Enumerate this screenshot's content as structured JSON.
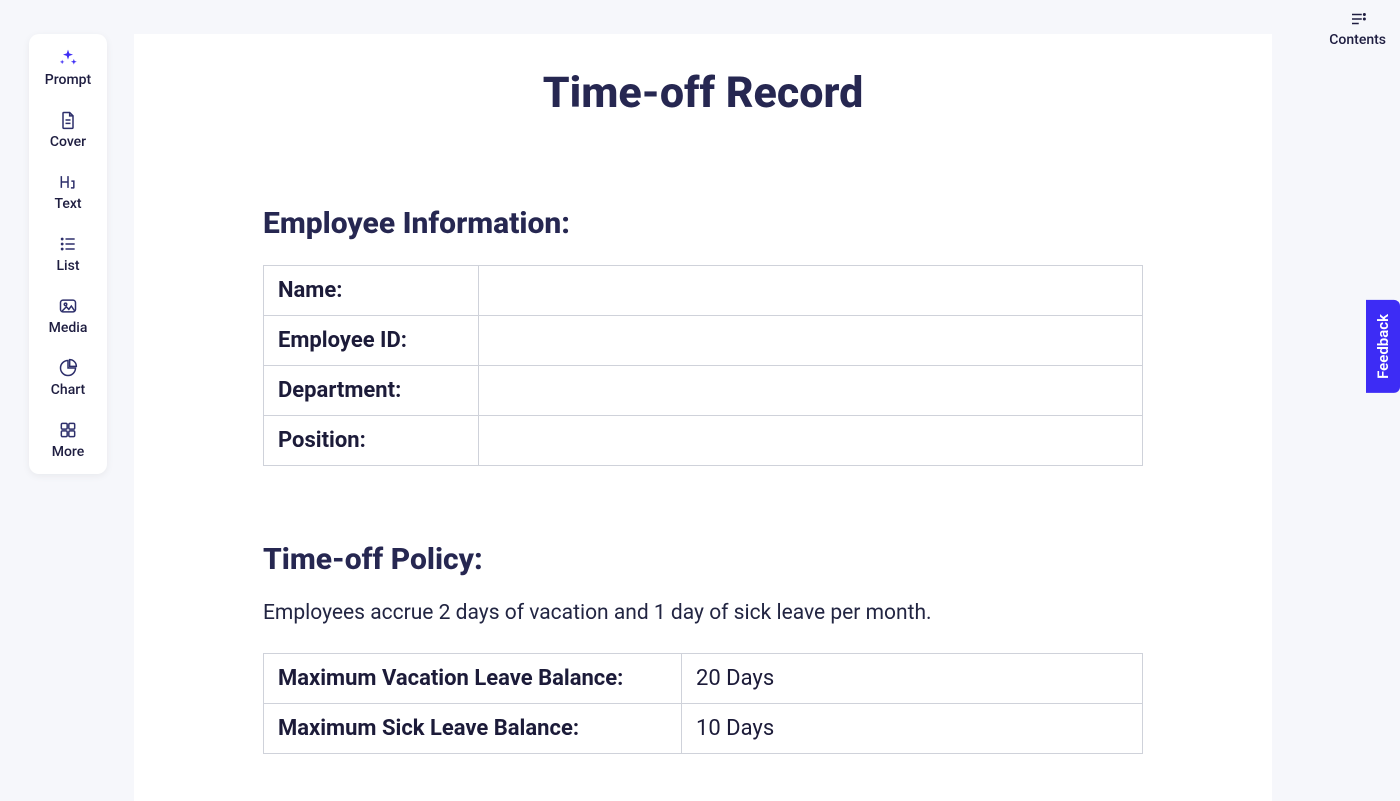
{
  "sidebar": {
    "items": [
      {
        "label": "Prompt"
      },
      {
        "label": "Cover"
      },
      {
        "label": "Text"
      },
      {
        "label": "List"
      },
      {
        "label": "Media"
      },
      {
        "label": "Chart"
      },
      {
        "label": "More"
      }
    ]
  },
  "contents": {
    "label": "Contents"
  },
  "feedback": {
    "label": "Feedback"
  },
  "doc": {
    "title": "Time-off Record",
    "employee_heading": "Employee Information:",
    "employee_rows": [
      {
        "key": "Name:",
        "value": ""
      },
      {
        "key": "Employee ID:",
        "value": ""
      },
      {
        "key": "Department:",
        "value": ""
      },
      {
        "key": "Position:",
        "value": ""
      }
    ],
    "policy_heading": "Time-off Policy:",
    "policy_text": "Employees accrue 2 days of vacation and 1 day of sick leave per month.",
    "policy_rows": [
      {
        "key": "Maximum Vacation Leave Balance:",
        "value": "20 Days"
      },
      {
        "key": "Maximum Sick Leave Balance:",
        "value": "10 Days"
      }
    ]
  }
}
